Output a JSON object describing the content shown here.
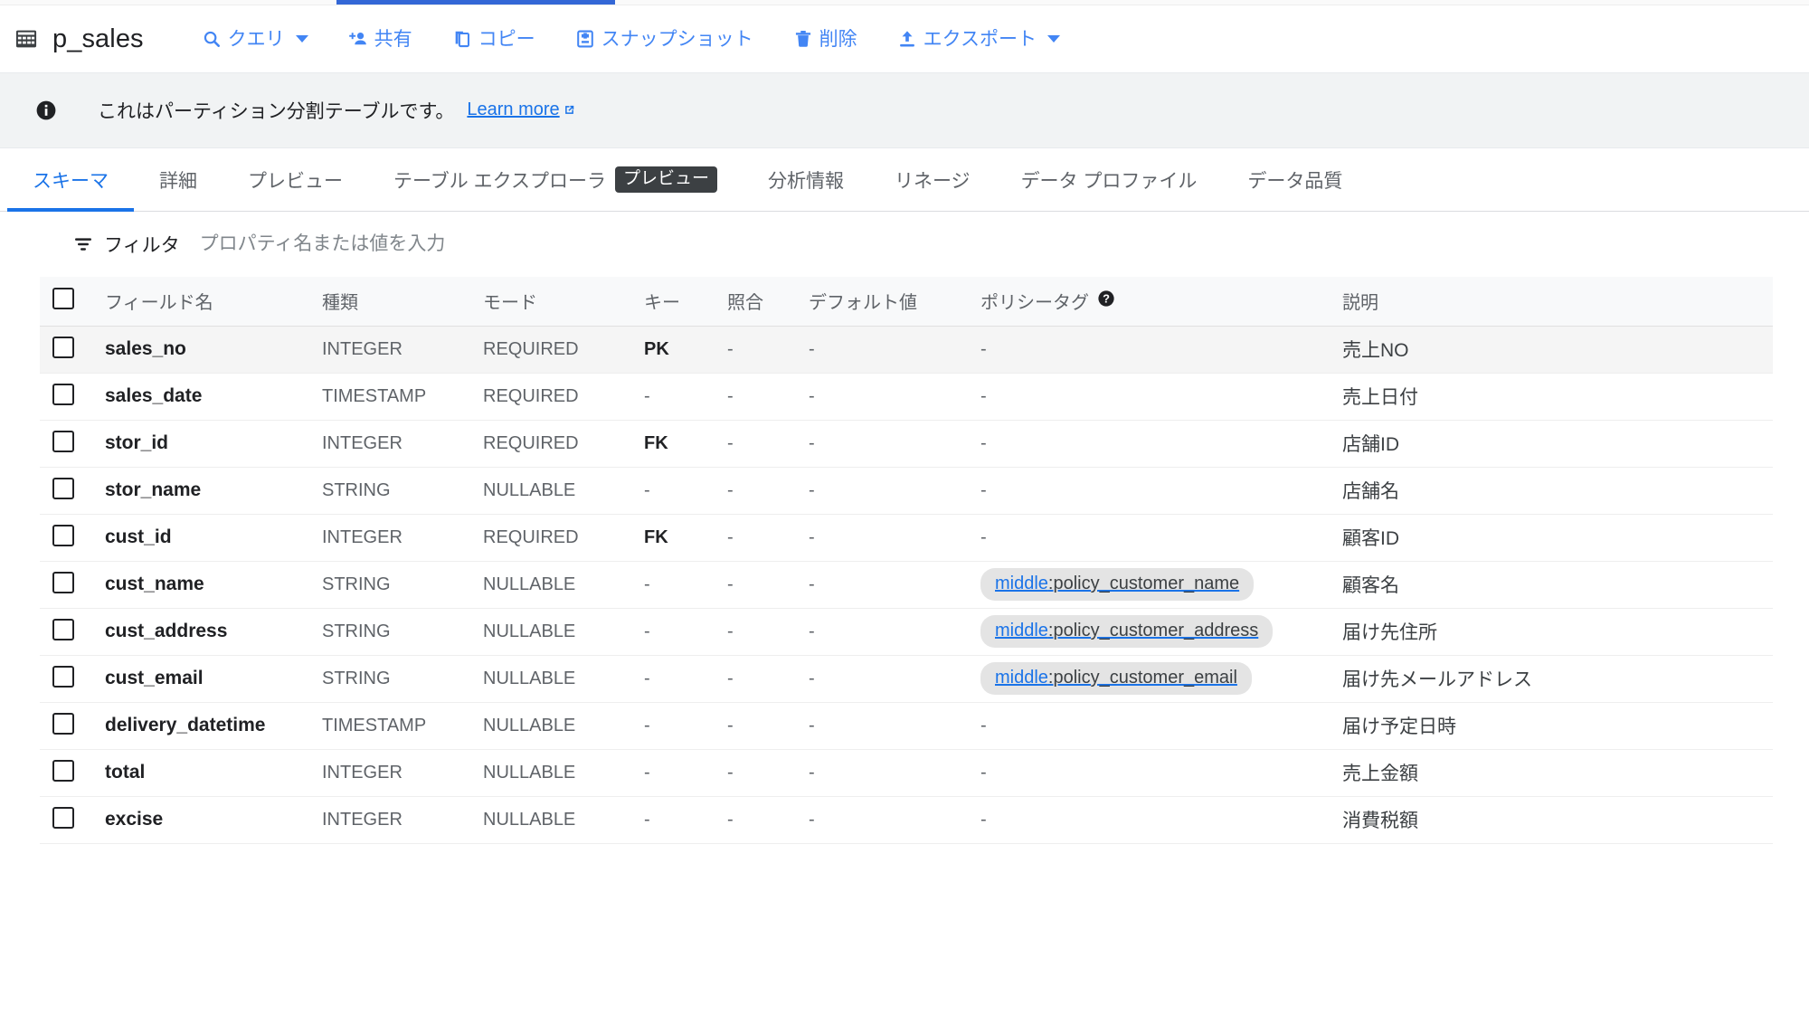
{
  "header": {
    "table_icon": "table-icon",
    "title": "p_sales",
    "toolbar": [
      {
        "label": "クエリ",
        "icon": "search-icon",
        "has_caret": true
      },
      {
        "label": "共有",
        "icon": "person-add-icon",
        "has_caret": false
      },
      {
        "label": "コピー",
        "icon": "copy-icon",
        "has_caret": false
      },
      {
        "label": "スナップショット",
        "icon": "snapshot-icon",
        "has_caret": false
      },
      {
        "label": "削除",
        "icon": "trash-icon",
        "has_caret": false
      },
      {
        "label": "エクスポート",
        "icon": "export-upload-icon",
        "has_caret": true
      }
    ]
  },
  "banner": {
    "icon": "info-icon",
    "text": "これはパーティション分割テーブルです。",
    "link_label": "Learn more",
    "link_icon": "external-link-icon"
  },
  "tabs": [
    {
      "label": "スキーマ",
      "active": true,
      "badge": ""
    },
    {
      "label": "詳細",
      "active": false,
      "badge": ""
    },
    {
      "label": "プレビュー",
      "active": false,
      "badge": ""
    },
    {
      "label": "テーブル エクスプローラ",
      "active": false,
      "badge": "プレビュー"
    },
    {
      "label": "分析情報",
      "active": false,
      "badge": ""
    },
    {
      "label": "リネージ",
      "active": false,
      "badge": ""
    },
    {
      "label": "データ プロファイル",
      "active": false,
      "badge": ""
    },
    {
      "label": "データ品質",
      "active": false,
      "badge": ""
    }
  ],
  "filter": {
    "icon": "filter-icon",
    "label": "フィルタ",
    "placeholder": "プロパティ名または値を入力",
    "value": ""
  },
  "schema_table": {
    "columns": [
      {
        "key": "checkbox",
        "label": ""
      },
      {
        "key": "name",
        "label": "フィールド名"
      },
      {
        "key": "type",
        "label": "種類"
      },
      {
        "key": "mode",
        "label": "モード"
      },
      {
        "key": "pkey",
        "label": "キー"
      },
      {
        "key": "collation",
        "label": "照合"
      },
      {
        "key": "default",
        "label": "デフォルト値"
      },
      {
        "key": "policy",
        "label": "ポリシータグ",
        "help_icon": "help-icon"
      },
      {
        "key": "description",
        "label": "説明"
      }
    ],
    "rows": [
      {
        "name": "sales_no",
        "type": "INTEGER",
        "mode": "REQUIRED",
        "pkey": "PK",
        "collation": "-",
        "default": "-",
        "policy": "-",
        "policy_chip": null,
        "description": "売上NO",
        "highlight": true
      },
      {
        "name": "sales_date",
        "type": "TIMESTAMP",
        "mode": "REQUIRED",
        "pkey": "-",
        "collation": "-",
        "default": "-",
        "policy": "-",
        "policy_chip": null,
        "description": "売上日付",
        "highlight": false
      },
      {
        "name": "stor_id",
        "type": "INTEGER",
        "mode": "REQUIRED",
        "pkey": "FK",
        "collation": "-",
        "default": "-",
        "policy": "-",
        "policy_chip": null,
        "description": "店舗ID",
        "highlight": false
      },
      {
        "name": "stor_name",
        "type": "STRING",
        "mode": "NULLABLE",
        "pkey": "-",
        "collation": "-",
        "default": "-",
        "policy": "-",
        "policy_chip": null,
        "description": "店舗名",
        "highlight": false
      },
      {
        "name": "cust_id",
        "type": "INTEGER",
        "mode": "REQUIRED",
        "pkey": "FK",
        "collation": "-",
        "default": "-",
        "policy": "-",
        "policy_chip": null,
        "description": "顧客ID",
        "highlight": false
      },
      {
        "name": "cust_name",
        "type": "STRING",
        "mode": "NULLABLE",
        "pkey": "-",
        "collation": "-",
        "default": "-",
        "policy": "",
        "policy_chip": {
          "taxonomy": "middle",
          "separator": " : ",
          "tag": "policy_customer_name"
        },
        "description": "顧客名",
        "highlight": false
      },
      {
        "name": "cust_address",
        "type": "STRING",
        "mode": "NULLABLE",
        "pkey": "-",
        "collation": "-",
        "default": "-",
        "policy": "",
        "policy_chip": {
          "taxonomy": "middle",
          "separator": " : ",
          "tag": "policy_customer_address"
        },
        "description": "届け先住所",
        "highlight": false
      },
      {
        "name": "cust_email",
        "type": "STRING",
        "mode": "NULLABLE",
        "pkey": "-",
        "collation": "-",
        "default": "-",
        "policy": "",
        "policy_chip": {
          "taxonomy": "middle",
          "separator": " : ",
          "tag": "policy_customer_email"
        },
        "description": "届け先メールアドレス",
        "highlight": false
      },
      {
        "name": "delivery_datetime",
        "type": "TIMESTAMP",
        "mode": "NULLABLE",
        "pkey": "-",
        "collation": "-",
        "default": "-",
        "policy": "-",
        "policy_chip": null,
        "description": "届け予定日時",
        "highlight": false
      },
      {
        "name": "total",
        "type": "INTEGER",
        "mode": "NULLABLE",
        "pkey": "-",
        "collation": "-",
        "default": "-",
        "policy": "-",
        "policy_chip": null,
        "description": "売上金額",
        "highlight": false
      },
      {
        "name": "excise",
        "type": "INTEGER",
        "mode": "NULLABLE",
        "pkey": "-",
        "collation": "-",
        "default": "-",
        "policy": "-",
        "policy_chip": null,
        "description": "消費税額",
        "highlight": false
      }
    ]
  },
  "colors": {
    "accent_blue": "#1a73e8",
    "toolbar_blue": "#4285f4",
    "tab_indicator": "#3367d6",
    "banner_bg": "#f1f3f4",
    "row_highlight": "#f5f5f5",
    "badge_bg": "#3c4043",
    "chip_bg": "#e4e4e4"
  }
}
